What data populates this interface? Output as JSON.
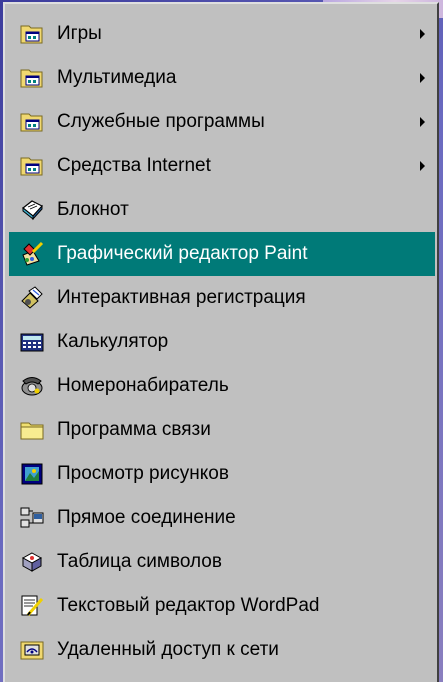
{
  "menu": {
    "items": [
      {
        "label": "Игры",
        "icon": "program-group-folder-icon",
        "submenu": true,
        "selected": false
      },
      {
        "label": "Мультимедиа",
        "icon": "program-group-folder-icon",
        "submenu": true,
        "selected": false
      },
      {
        "label": "Служебные программы",
        "icon": "program-group-folder-icon",
        "submenu": true,
        "selected": false
      },
      {
        "label": "Средства Internet",
        "icon": "program-group-folder-icon",
        "submenu": true,
        "selected": false
      },
      {
        "label": "Блокнот",
        "icon": "notepad-icon",
        "submenu": false,
        "selected": false
      },
      {
        "label": "Графический редактор Paint",
        "icon": "paint-icon",
        "submenu": false,
        "selected": true
      },
      {
        "label": "Интерактивная регистрация",
        "icon": "registration-icon",
        "submenu": false,
        "selected": false
      },
      {
        "label": "Калькулятор",
        "icon": "calculator-icon",
        "submenu": false,
        "selected": false
      },
      {
        "label": "Номеронабиратель",
        "icon": "phone-dialer-icon",
        "submenu": false,
        "selected": false
      },
      {
        "label": "Программа связи",
        "icon": "folder-icon",
        "submenu": false,
        "selected": false
      },
      {
        "label": "Просмотр рисунков",
        "icon": "image-viewer-icon",
        "submenu": false,
        "selected": false
      },
      {
        "label": "Прямое соединение",
        "icon": "direct-connection-icon",
        "submenu": false,
        "selected": false
      },
      {
        "label": "Таблица символов",
        "icon": "character-map-icon",
        "submenu": false,
        "selected": false
      },
      {
        "label": "Текстовый редактор WordPad",
        "icon": "wordpad-icon",
        "submenu": false,
        "selected": false
      },
      {
        "label": "Удаленный доступ к сети",
        "icon": "dial-up-networking-icon",
        "submenu": false,
        "selected": false
      }
    ],
    "selected_color": "#007a78",
    "background_color": "#c0c0c0"
  }
}
